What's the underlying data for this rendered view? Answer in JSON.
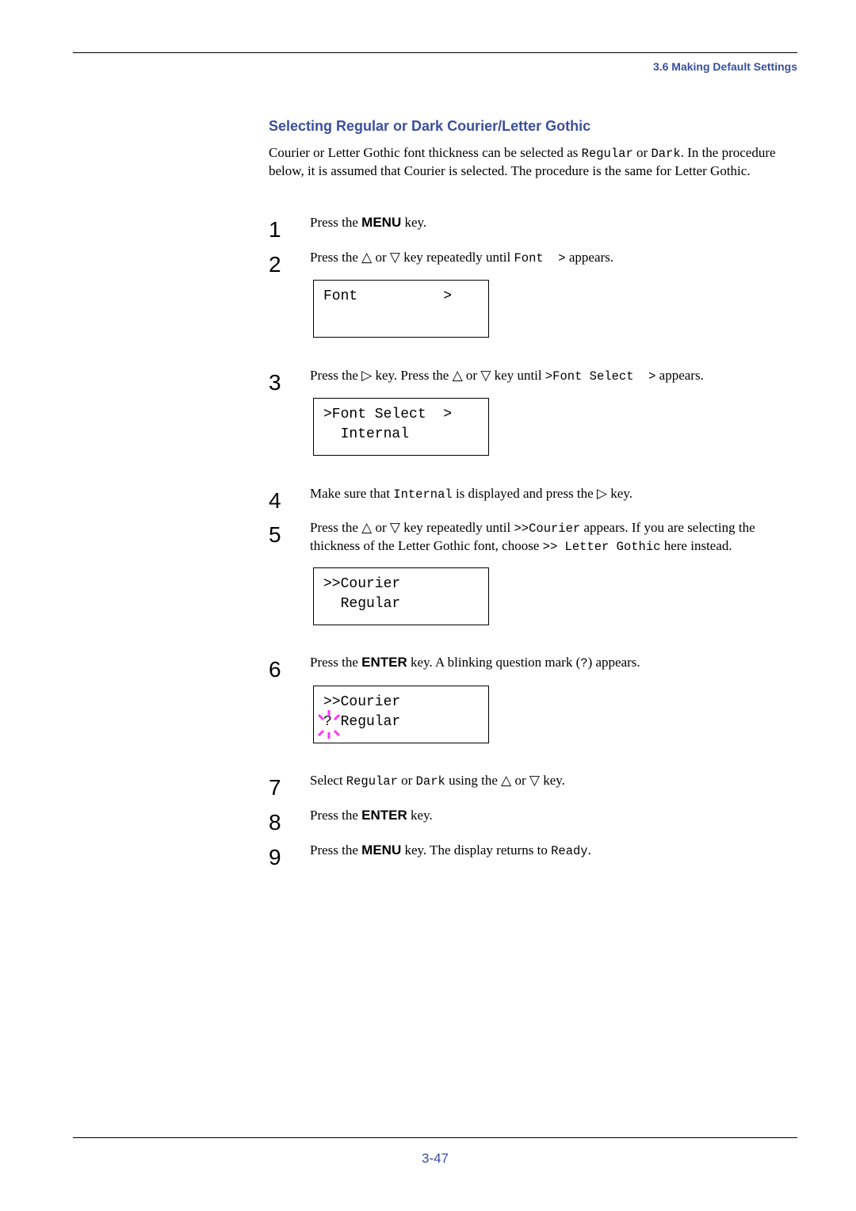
{
  "header": {
    "section": "3.6 Making Default Settings"
  },
  "title": "Selecting Regular or Dark Courier/Letter Gothic",
  "intro": [
    {
      "s": "t",
      "v": "Courier or Letter Gothic font thickness can be selected as "
    },
    {
      "s": "m",
      "v": "Regular"
    },
    {
      "s": "t",
      "v": " or "
    },
    {
      "s": "m",
      "v": "Dark"
    },
    {
      "s": "t",
      "v": ". In the procedure below, it is assumed that Courier is selected. The procedure is the same for Letter Gothic."
    }
  ],
  "steps": [
    {
      "num": "1",
      "text": [
        {
          "s": "t",
          "v": "Press the "
        },
        {
          "s": "b",
          "v": "MENU"
        },
        {
          "s": "t",
          "v": " key."
        }
      ]
    },
    {
      "num": "2",
      "text": [
        {
          "s": "t",
          "v": "Press the △ or ▽ key repeatedly until "
        },
        {
          "s": "m",
          "v": "Font  >"
        },
        {
          "s": "t",
          "v": " appears."
        }
      ],
      "lcd": [
        "Font          >",
        ""
      ]
    },
    {
      "num": "3",
      "text": [
        {
          "s": "t",
          "v": "Press the ▷ key. Press the △ or ▽ key until "
        },
        {
          "s": "m",
          "v": ">Font Select  >"
        },
        {
          "s": "t",
          "v": " appears."
        }
      ],
      "lcd": [
        ">Font Select  >",
        "  Internal"
      ]
    },
    {
      "num": "4",
      "text": [
        {
          "s": "t",
          "v": "Make sure that "
        },
        {
          "s": "m",
          "v": "Internal"
        },
        {
          "s": "t",
          "v": " is displayed and press the ▷ key."
        }
      ]
    },
    {
      "num": "5",
      "text": [
        {
          "s": "t",
          "v": "Press the △ or ▽ key repeatedly until "
        },
        {
          "s": "m",
          "v": ">>Courier"
        },
        {
          "s": "t",
          "v": " appears. If you are selecting the thickness of the Letter Gothic font, choose "
        },
        {
          "s": "m",
          "v": ">> Letter Gothic"
        },
        {
          "s": "t",
          "v": " here instead."
        }
      ],
      "lcd": [
        ">>Courier",
        "  Regular"
      ]
    },
    {
      "num": "6",
      "text": [
        {
          "s": "t",
          "v": "Press the "
        },
        {
          "s": "b",
          "v": "ENTER"
        },
        {
          "s": "t",
          "v": " key. A blinking question mark ("
        },
        {
          "s": "m",
          "v": "?"
        },
        {
          "s": "t",
          "v": ") appears."
        }
      ],
      "lcd": [
        ">>Courier",
        "? Regular"
      ],
      "blink_color": "#ff33ff"
    },
    {
      "num": "7",
      "text": [
        {
          "s": "t",
          "v": "Select "
        },
        {
          "s": "m",
          "v": "Regular"
        },
        {
          "s": "t",
          "v": " or "
        },
        {
          "s": "m",
          "v": "Dark"
        },
        {
          "s": "t",
          "v": " using the △ or ▽ key."
        }
      ]
    },
    {
      "num": "8",
      "text": [
        {
          "s": "t",
          "v": "Press the "
        },
        {
          "s": "b",
          "v": "ENTER"
        },
        {
          "s": "t",
          "v": " key."
        }
      ]
    },
    {
      "num": "9",
      "text": [
        {
          "s": "t",
          "v": "Press the "
        },
        {
          "s": "b",
          "v": "MENU"
        },
        {
          "s": "t",
          "v": " key. The display returns to "
        },
        {
          "s": "m",
          "v": "Ready"
        },
        {
          "s": "t",
          "v": "."
        }
      ]
    }
  ],
  "footer": {
    "page": "3-47"
  },
  "colors": {
    "accent": "#3a4fa0",
    "blink": "#ff33ff"
  }
}
